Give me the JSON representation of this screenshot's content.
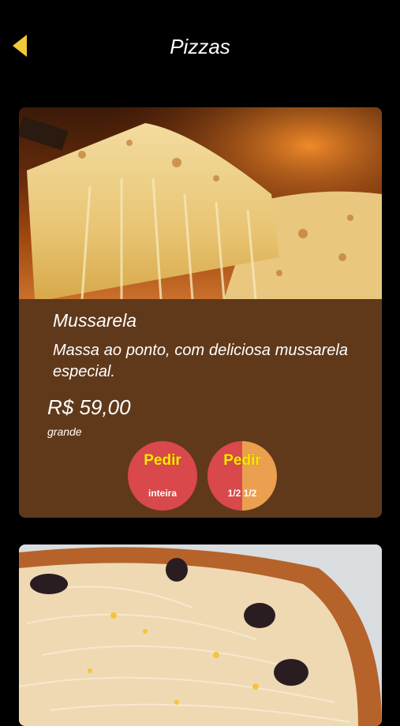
{
  "header": {
    "title": "Pizzas",
    "back_icon": "back-arrow-icon",
    "accent_color": "#f3c83a"
  },
  "menu": {
    "items": [
      {
        "name": "Mussarela",
        "description": "Massa ao ponto, com deliciosa mussarela especial.",
        "price": "R$ 59,00",
        "size": "grande",
        "buttons": {
          "whole": {
            "main": "Pedir",
            "sub": "inteira"
          },
          "half": {
            "main": "Pedir",
            "sub": "1/2 1/2"
          }
        }
      }
    ]
  },
  "colors": {
    "card_background": "#60391b",
    "button_red": "#d9484a",
    "button_orange": "#eba04f",
    "button_text_yellow": "#ffe800"
  }
}
